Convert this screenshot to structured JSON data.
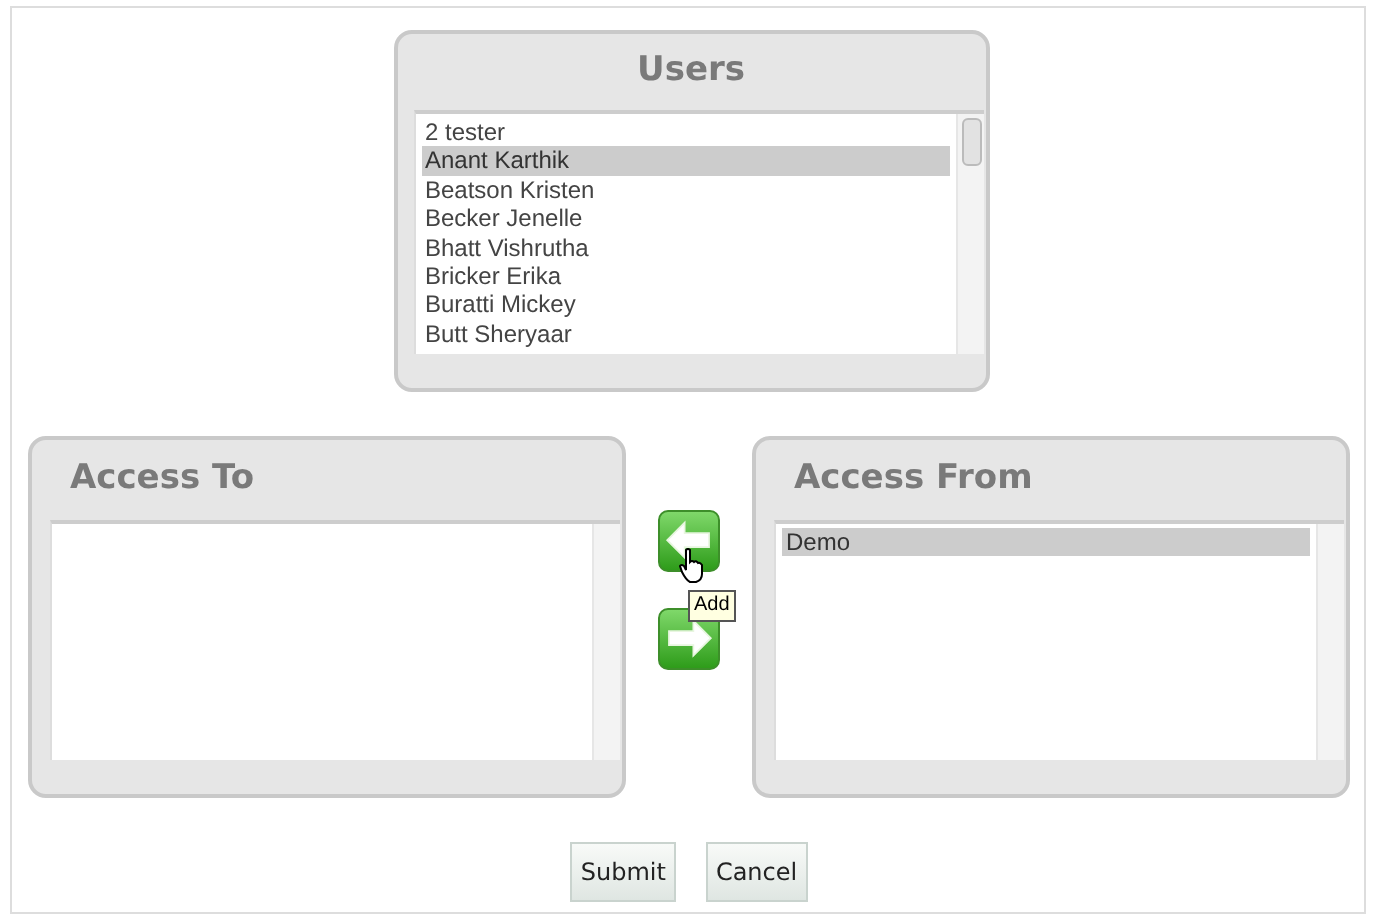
{
  "users": {
    "title": "Users",
    "items": [
      {
        "label": "2 tester",
        "selected": false
      },
      {
        "label": "Anant Karthik",
        "selected": true
      },
      {
        "label": "Beatson Kristen",
        "selected": false
      },
      {
        "label": "Becker Jenelle",
        "selected": false
      },
      {
        "label": "Bhatt Vishrutha",
        "selected": false
      },
      {
        "label": "Bricker Erika",
        "selected": false
      },
      {
        "label": "Buratti Mickey",
        "selected": false
      },
      {
        "label": "Butt Sheryaar",
        "selected": false
      }
    ]
  },
  "access_to": {
    "title": "Access To"
  },
  "transfer_buttons": [
    {
      "kind": "left",
      "tooltip": "Add"
    },
    {
      "kind": "right"
    }
  ],
  "access_from": {
    "title": "Access From",
    "items": [
      {
        "label": "Demo",
        "selected": true
      }
    ]
  },
  "buttons": [
    "Submit",
    "Cancel"
  ]
}
